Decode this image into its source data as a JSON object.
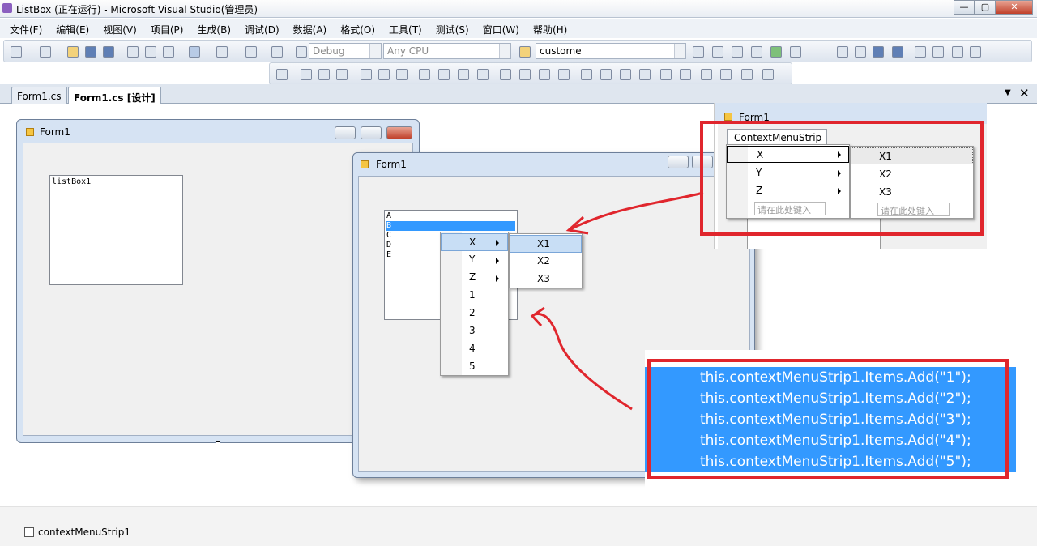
{
  "window": {
    "title": "ListBox (正在运行) - Microsoft Visual Studio(管理员)",
    "min": "—",
    "max": "▢",
    "close": "✕"
  },
  "menu": [
    "文件(F)",
    "编辑(E)",
    "视图(V)",
    "项目(P)",
    "生成(B)",
    "调试(D)",
    "数据(A)",
    "格式(O)",
    "工具(T)",
    "测试(S)",
    "窗口(W)",
    "帮助(H)"
  ],
  "toolbar": {
    "config": "Debug",
    "platform": "Any CPU",
    "find": "custome"
  },
  "tabs": [
    "Form1.cs",
    "Form1.cs [设计]"
  ],
  "form_left": {
    "title": "Form1",
    "listbox_label": "listBox1"
  },
  "form_mid": {
    "title": "Form1",
    "list_items": [
      "A",
      "B",
      "C",
      "D",
      "E"
    ],
    "menu_items": [
      "X",
      "Y",
      "Z",
      "1",
      "2",
      "3",
      "4",
      "5"
    ],
    "submenu_items": [
      "X1",
      "X2",
      "X3"
    ]
  },
  "form_right": {
    "title": "Form1",
    "strip_label": "ContextMenuStrip",
    "menu_items": [
      "X",
      "Y",
      "Z"
    ],
    "type_here": "请在此处键入",
    "submenu_items": [
      "X1",
      "X2",
      "X3"
    ]
  },
  "code_lines": [
    "this.contextMenuStrip1.Items.Add(\"1\");",
    "this.contextMenuStrip1.Items.Add(\"2\");",
    "this.contextMenuStrip1.Items.Add(\"3\");",
    "this.contextMenuStrip1.Items.Add(\"4\");",
    "this.contextMenuStrip1.Items.Add(\"5\");"
  ],
  "component_tray": {
    "item": "contextMenuStrip1"
  },
  "accent": "#3399ff",
  "annotation_color": "#e0262d"
}
